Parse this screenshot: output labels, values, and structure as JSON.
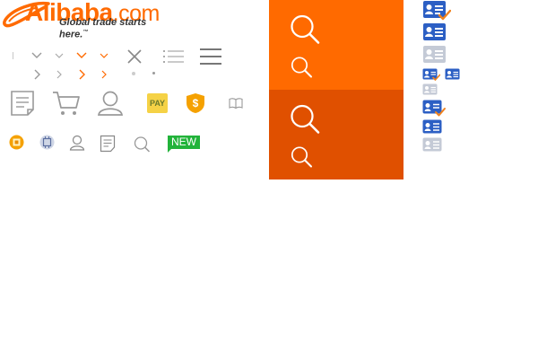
{
  "logo": {
    "brand": "Alibaba",
    "domain": ".com",
    "tagline": "Global trade starts here.",
    "trademark": "™"
  },
  "badges": {
    "pay_label": "PAY",
    "new_label": "NEW"
  },
  "colors": {
    "brand_orange": "#ff6a00",
    "panel_dark_orange": "#e05000",
    "icon_gray": "#999999",
    "icon_dark_gray": "#888888",
    "icon_blue": "#2c5fc4",
    "check_orange": "#f0821e",
    "pay_yellow": "#f5d246",
    "new_green": "#22b33a",
    "gold": "#f5a100"
  },
  "icons": [
    "divider-bar-icon",
    "chevron-down-icon",
    "close-icon",
    "list-icon",
    "menu-icon",
    "chevron-right-icon",
    "dot-icon",
    "document-icon",
    "cart-icon",
    "user-icon",
    "shield-dollar-icon",
    "book-icon",
    "gold-supplier-icon",
    "chip-icon",
    "search-icon",
    "contact-card-check-icon",
    "contact-card-icon"
  ]
}
